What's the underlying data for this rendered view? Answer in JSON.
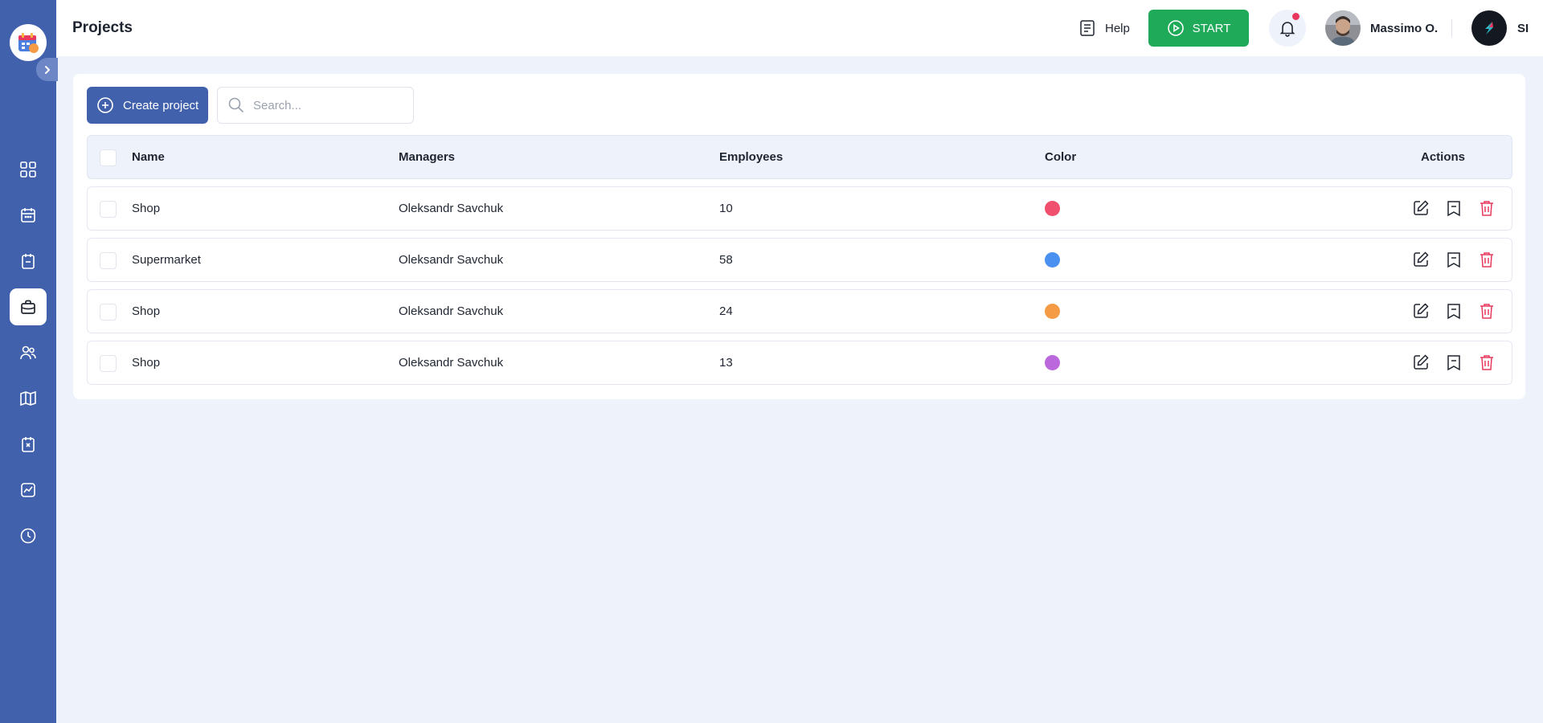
{
  "header": {
    "title": "Projects",
    "help_label": "Help",
    "start_label": "START",
    "user_name": "Massimo O.",
    "org_label": "SI"
  },
  "sidebar": {
    "items": [
      {
        "icon": "grid-icon"
      },
      {
        "icon": "calendar-icon"
      },
      {
        "icon": "clipboard-icon"
      },
      {
        "icon": "briefcase-icon",
        "active": true
      },
      {
        "icon": "users-icon"
      },
      {
        "icon": "map-icon"
      },
      {
        "icon": "calendar-cancel-icon"
      },
      {
        "icon": "chart-icon"
      },
      {
        "icon": "clock-icon"
      }
    ]
  },
  "toolbar": {
    "create_label": "Create project",
    "search_placeholder": "Search..."
  },
  "table": {
    "columns": [
      "Name",
      "Managers",
      "Employees",
      "Color",
      "Actions"
    ],
    "rows": [
      {
        "name": "Shop",
        "manager": "Oleksandr Savchuk",
        "employees": "10",
        "color": "#f0506e"
      },
      {
        "name": "Supermarket",
        "manager": "Oleksandr Savchuk",
        "employees": "58",
        "color": "#4a90f0"
      },
      {
        "name": "Shop",
        "manager": "Oleksandr Savchuk",
        "employees": "24",
        "color": "#f59a45"
      },
      {
        "name": "Shop",
        "manager": "Oleksandr Savchuk",
        "employees": "13",
        "color": "#bb68dd"
      }
    ]
  },
  "colors": {
    "primary": "#4261ad",
    "start": "#1faa59",
    "delete": "#e8385e",
    "notification": "#e8385e"
  }
}
